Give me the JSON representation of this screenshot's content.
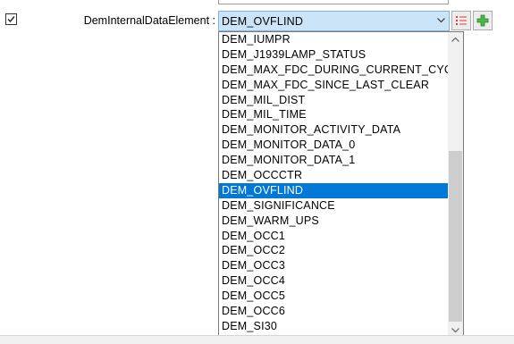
{
  "field": {
    "label": "DemInternalDataElement :",
    "selected_value": "DEM_OVFLIND",
    "checkbox_checked": true
  },
  "buttons": {
    "list_icon": "list-icon",
    "add_icon": "plus-icon"
  },
  "dropdown": {
    "options": [
      "DEM_IUMPR",
      "DEM_J1939LAMP_STATUS",
      "DEM_MAX_FDC_DURING_CURRENT_CYCLE",
      "DEM_MAX_FDC_SINCE_LAST_CLEAR",
      "DEM_MIL_DIST",
      "DEM_MIL_TIME",
      "DEM_MONITOR_ACTIVITY_DATA",
      "DEM_MONITOR_DATA_0",
      "DEM_MONITOR_DATA_1",
      "DEM_OCCCTR",
      "DEM_OVFLIND",
      "DEM_SIGNIFICANCE",
      "DEM_WARM_UPS",
      "DEM_OCC1",
      "DEM_OCC2",
      "DEM_OCC3",
      "DEM_OCC4",
      "DEM_OCC5",
      "DEM_OCC6",
      "DEM_SI30"
    ],
    "selected_index": 10
  },
  "colors": {
    "selection": "#0078d7",
    "combo_focus": "#cce4f7",
    "list_icon": "#e03a3a",
    "add_icon": "#3aa63a"
  }
}
